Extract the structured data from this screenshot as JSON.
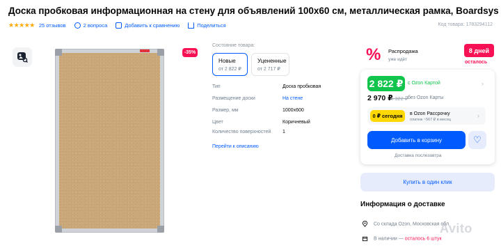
{
  "product": {
    "title": "Доска пробковая информационная на стену для объявлений 100х60 см, металлическая рамка, Boardsys",
    "reviews": "25 отзывов",
    "questions": "2 вопроса",
    "compare": "Добавить к сравнению",
    "share": "Поделиться",
    "code": "Код товара: 1783294112",
    "stars": "★★★★★"
  },
  "gallery": {
    "discount": "-35%"
  },
  "condition": {
    "label": "Состояние товара:",
    "options": [
      {
        "title": "Новые",
        "price": "от 2 822 ₽"
      },
      {
        "title": "Уцененные",
        "price": "от 2 717 ₽"
      }
    ]
  },
  "specs": [
    {
      "name": "Тип",
      "value": "Доска пробковая"
    },
    {
      "name": "Размещение доски",
      "value": "На стене"
    },
    {
      "name": "Размер, мм",
      "value": "1000x600"
    },
    {
      "name": "Цвет",
      "value": "Коричневый"
    },
    {
      "name": "Количество поверхностей",
      "value": "1"
    }
  ],
  "goto_description": "Перейти к описанию",
  "promo": {
    "title": "Распродажа",
    "subtitle": "уже идёт",
    "days": "8 дней",
    "left": "осталось"
  },
  "pricing": {
    "card_price": "2 822 ₽",
    "card_label": "c Ozon Картой",
    "regular_price": "2 970 ₽",
    "old_price": "4 322 ₽",
    "regular_label": "без Ozon Карты",
    "install_badge": "0 ₽ сегодня",
    "install_title": "в Ozon Рассрочку",
    "install_sub": "платеж ~567 ₽ в месяц",
    "cart_button": "Добавить в корзину",
    "delivery_note": "Доставка послезавтра",
    "one_click": "Купить в один клик"
  },
  "delivery": {
    "title": "Информация о доставке",
    "from": "Со склада Ozon, Московская обл.",
    "stock_prefix": "В наличии —",
    "stock_red": "осталось 6 штук"
  },
  "watermark": "Avito",
  "colors": {
    "accent": "#005bff",
    "sale": "#f91155",
    "green": "#10c44c",
    "yellow": "#ffd800"
  }
}
